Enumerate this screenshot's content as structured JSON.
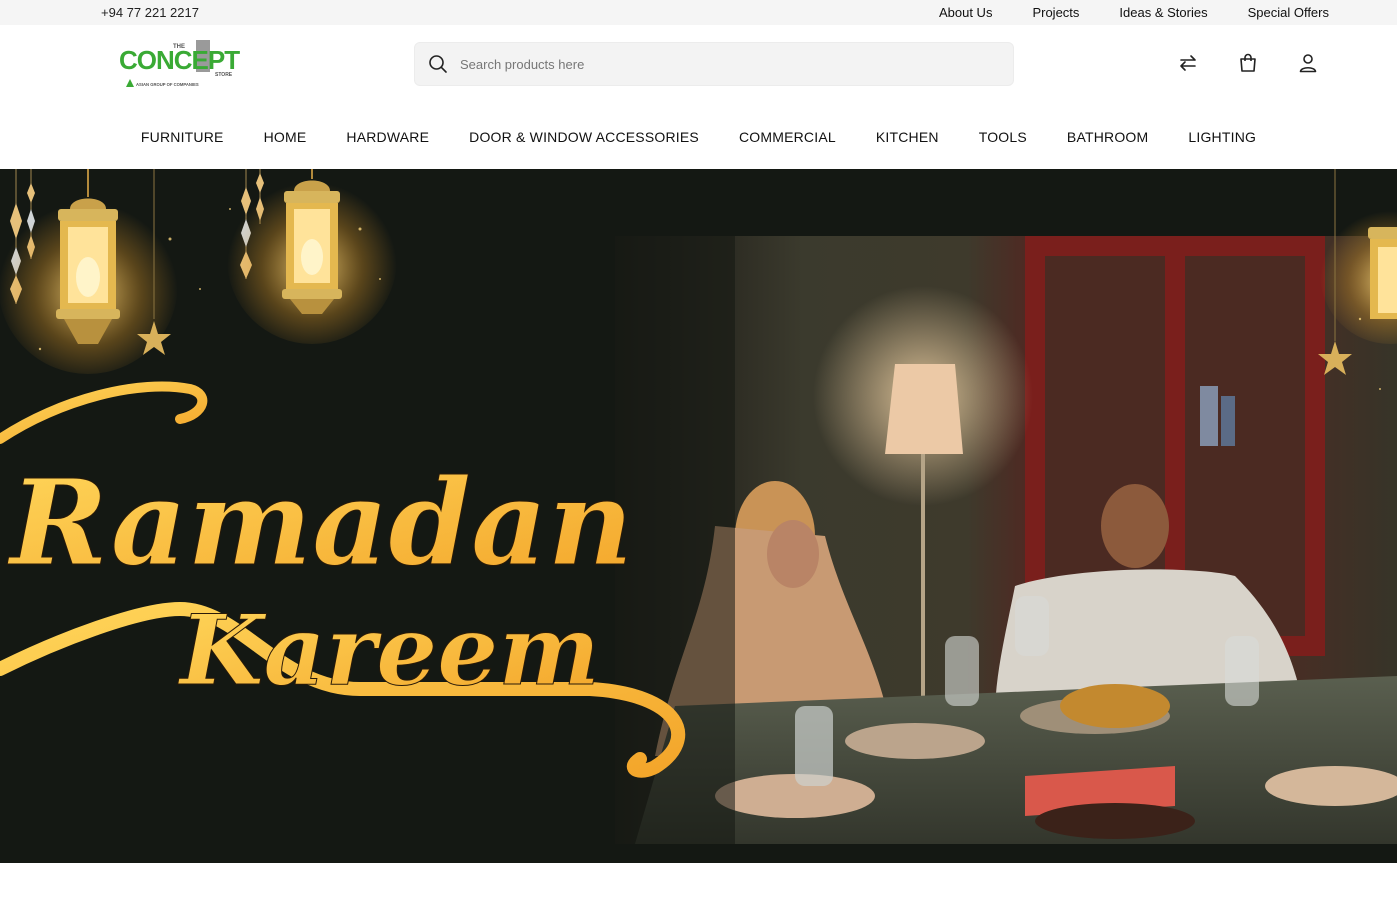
{
  "topbar": {
    "phone": "+94 77 221 2217",
    "links": [
      "About Us",
      "Projects",
      "Ideas & Stories",
      "Special Offers"
    ]
  },
  "header": {
    "logo": {
      "main": "CONCEPT",
      "prefix": "THE",
      "suffix": "STORE",
      "tagline": "ASIAN GROUP OF COMPANIES"
    },
    "search_placeholder": "Search products here",
    "icons": [
      "compare-arrows-icon",
      "shopping-bag-icon",
      "user-icon"
    ]
  },
  "nav": {
    "items": [
      "FURNITURE",
      "HOME",
      "HARDWARE",
      "DOOR & WINDOW ACCESSORIES",
      "COMMERCIAL",
      "KITCHEN",
      "TOOLS",
      "BATHROOM",
      "LIGHTING"
    ]
  },
  "hero": {
    "line1": "Ramadan",
    "line2": "Kareem"
  },
  "colors": {
    "brand_green": "#3aaa35",
    "hero_bg": "#141813",
    "gold": "#f6b52e",
    "topbar_bg": "#f5f5f5"
  }
}
